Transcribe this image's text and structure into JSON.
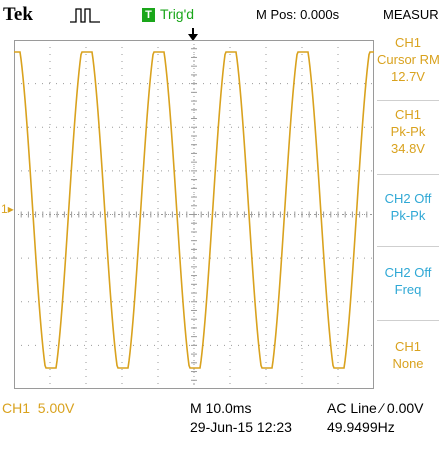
{
  "header": {
    "brand": "Tek",
    "acquire_icon": "acquisition-pulse-icon",
    "trigger_badge": "T",
    "trigger_status": "Trig'd",
    "horizontal_position": "M Pos: 0.000s",
    "menu_title": "MEASURE"
  },
  "waveform": {
    "channel_marker": "1",
    "color": "#d9a21e"
  },
  "measure_panel": [
    {
      "source": "CH1",
      "type": "Cursor RM",
      "value": "12.7V",
      "color": "#d9a21e"
    },
    {
      "source": "CH1",
      "type": "Pk-Pk",
      "value": "34.8V",
      "color": "#d9a21e"
    },
    {
      "source": "CH2 Off",
      "type": "Pk-Pk",
      "value": "",
      "color": "#2fa8d5"
    },
    {
      "source": "CH2 Off",
      "type": "Freq",
      "value": "",
      "color": "#2fa8d5"
    },
    {
      "source": "CH1",
      "type": "None",
      "value": "",
      "color": "#d9a21e"
    }
  ],
  "footer": {
    "ch1_scale": "CH1  5.00V",
    "timebase": "M 10.0ms",
    "datetime": "29-Jun-15 12:23",
    "trigger_info": "AC Line ∕ 0.00V",
    "frequency": "49.9499Hz"
  },
  "colors": {
    "ch1": "#d9a21e",
    "ch2": "#2fa8d5",
    "trigger": "#1aa61a",
    "grid": "#9a9a9a"
  }
}
